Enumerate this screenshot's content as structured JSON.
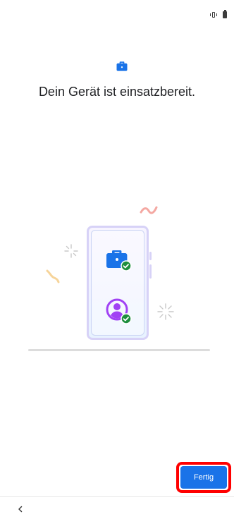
{
  "screen": {
    "title": "Dein Gerät ist einsatzbereit."
  },
  "actions": {
    "done_label": "Fertig"
  },
  "icons": {
    "status": [
      "vibrate-icon",
      "battery-icon"
    ],
    "header": "briefcase-icon",
    "navigation": "back-icon"
  },
  "colors": {
    "accent": "#1a73e8",
    "title_text": "#202124",
    "highlight_border": "#ff0000",
    "success_badge": "#1e8e3e",
    "person_icon": "#a142f4"
  }
}
